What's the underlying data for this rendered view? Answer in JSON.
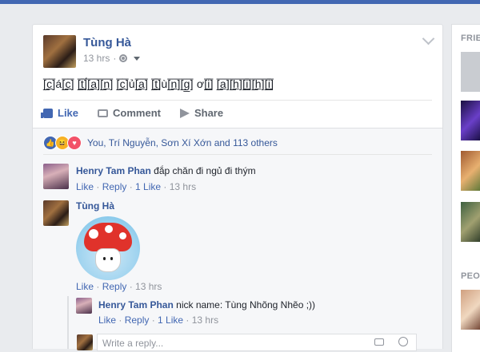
{
  "post": {
    "author": "Tùng Hà",
    "time": "13 hrs",
    "text": "[̲̅c̲̅]á[̲̅c̲̅] [̲̅t̲̅]́[̲̅a̲̅][̲̅n̲̅] [̲̅c̲̅]ủ[̲̅a̲̅] [̲̅t̲̅]ù[̲̅n̲̅][̲̅g̲̅] ơ[̲̅i̲̅] [̲̅a̲̅][̲̅h̲̅][̲̅i̲̅][̲̅h̲̅][̲̅i̲̅]",
    "actions": {
      "like": "Like",
      "comment": "Comment",
      "share": "Share"
    },
    "reactions_text": "You, Trí Nguyễn, Sơn Xí Xớn and 113 others",
    "reaction_icons": [
      "like-reaction-icon",
      "haha-reaction-icon",
      "love-reaction-icon"
    ]
  },
  "comments": [
    {
      "author": "Henry Tam Phan",
      "text": "đắp chăn đi ngủ đi thým",
      "like": "Like",
      "reply": "Reply",
      "likes": "1 Like",
      "time": "13 hrs"
    },
    {
      "author": "Tùng Hà",
      "sticker": "mushroom-sticker",
      "like": "Like",
      "reply": "Reply",
      "time": "13 hrs"
    }
  ],
  "reply": {
    "author": "Henry Tam Phan",
    "text": "nick name: Tùng Nhõng Nhẽo ;))",
    "like": "Like",
    "reply": "Reply",
    "likes": "1 Like",
    "time": "13 hrs"
  },
  "reply_box": {
    "placeholder": "Write a reply..."
  },
  "sidebar": {
    "heading_1": "FRIE",
    "heading_2": "PEOI"
  },
  "colors": {
    "brand": "#4267b2",
    "link": "#365899",
    "muted": "#90949c",
    "background": "#e9ebee"
  }
}
